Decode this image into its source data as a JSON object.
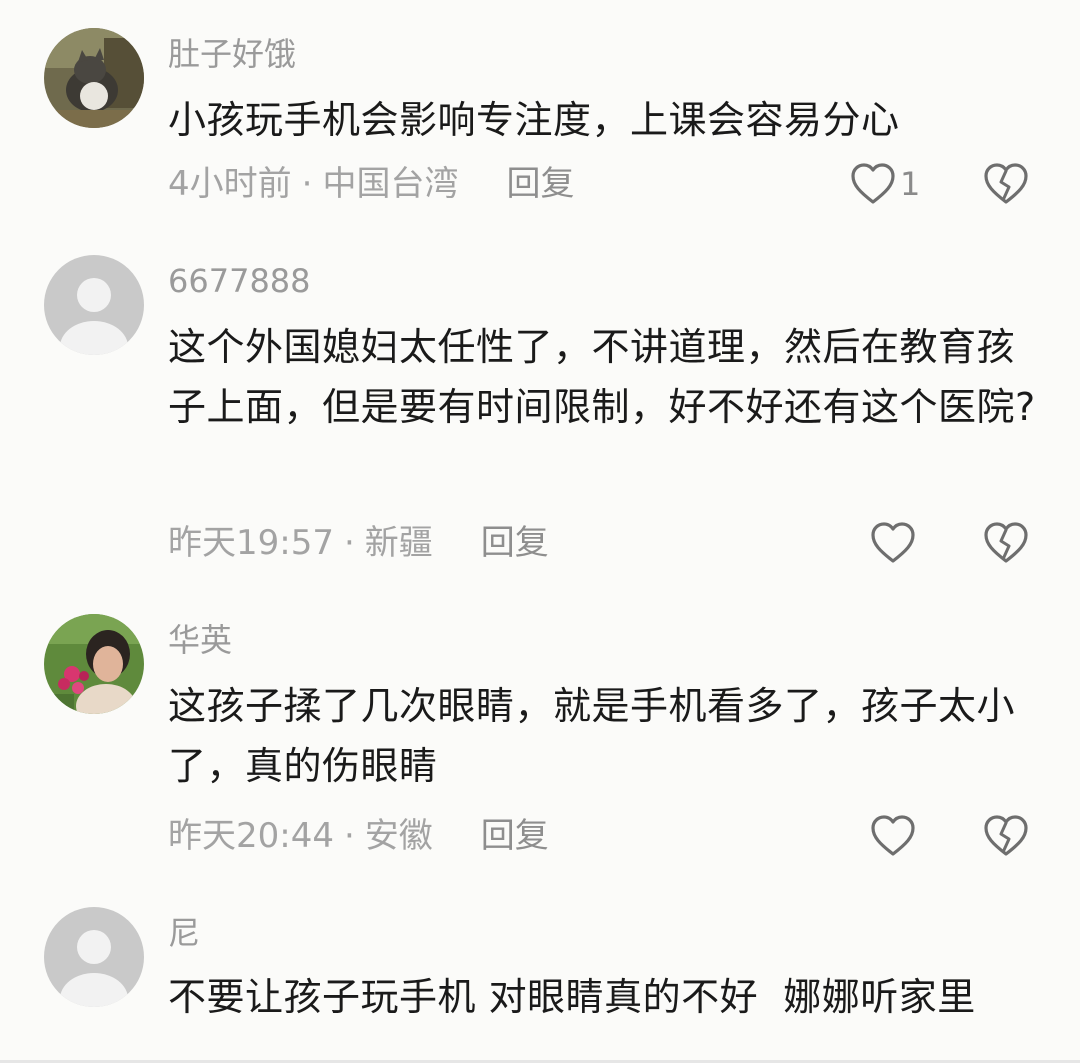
{
  "comments": [
    {
      "username": "肚子好饿",
      "avatar": "cat-photo-avatar",
      "content": "小孩玩手机会影响专注度，上课会容易分心",
      "time": "4小时前",
      "location": "中国台湾",
      "reply_label": "回复",
      "like_count": "1"
    },
    {
      "username": "6677888",
      "avatar": "default-user-avatar",
      "content": "这个外国媳妇太任性了，不讲道理，然后在教育孩子上面，但是要有时间限制，好不好还有这个医院?",
      "time": "昨天19:57",
      "location": "新疆",
      "reply_label": "回复",
      "like_count": ""
    },
    {
      "username": "华英",
      "avatar": "woman-with-flowers-avatar",
      "content": "这孩子揉了几次眼睛，就是手机看多了，孩子太小了，真的伤眼睛",
      "time": "昨天20:44",
      "location": "安徽",
      "reply_label": "回复",
      "like_count": ""
    },
    {
      "username": "尼",
      "avatar": "default-user-avatar",
      "content": "不要让孩子玩手机 对眼睛真的不好  娜娜听家里",
      "time": "",
      "location": "",
      "reply_label": "",
      "like_count": ""
    }
  ],
  "separator": "·",
  "icons": {
    "like": "heart-outline-icon",
    "dislike": "broken-heart-icon"
  },
  "colors": {
    "background": "#fbfbf9",
    "text": "#1a1a1a",
    "secondary": "#9a9a9a",
    "icon": "#6e6e6e"
  }
}
